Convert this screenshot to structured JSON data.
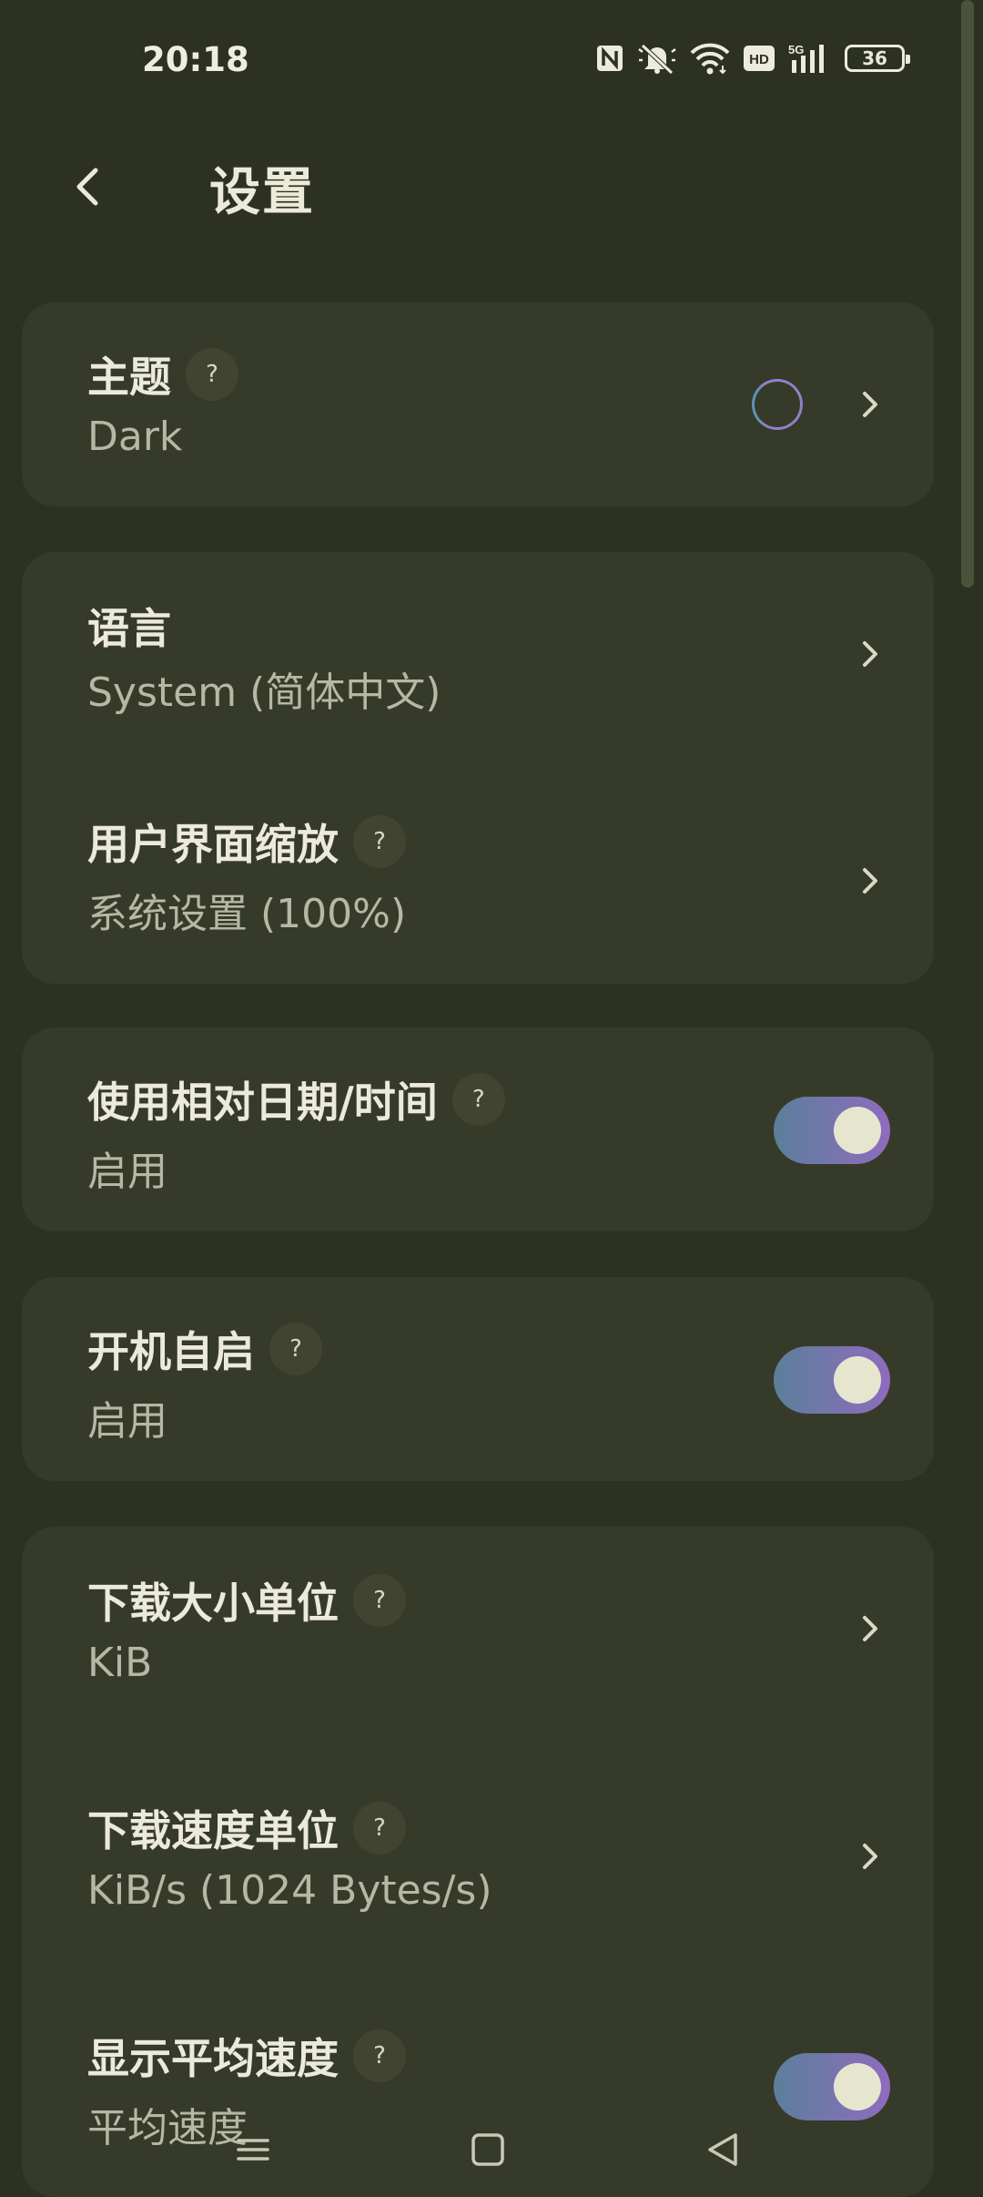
{
  "status_bar": {
    "time": "20:18",
    "icons": [
      "nfc-icon",
      "mute-icon",
      "wifi-icon",
      "hd-icon",
      "5g-signal-icon"
    ],
    "battery_level": "36"
  },
  "app_bar": {
    "title": "设置",
    "back_icon": "back-arrow-icon"
  },
  "settings": {
    "theme": {
      "title": "主题",
      "value": "Dark"
    },
    "language": {
      "title": "语言",
      "value": "System (简体中文)"
    },
    "ui_scale": {
      "title": "用户界面缩放",
      "value": "系统设置 (100%)"
    },
    "relative_date": {
      "title": "使用相对日期/时间",
      "value": "启用",
      "enabled": true
    },
    "autostart": {
      "title": "开机自启",
      "value": "启用",
      "enabled": true
    },
    "download_size_unit": {
      "title": "下载大小单位",
      "value": "KiB"
    },
    "download_speed_unit": {
      "title": "下载速度单位",
      "value": "KiB/s (1024 Bytes/s)"
    },
    "avg_speed": {
      "title": "显示平均速度",
      "value": "平均速度",
      "enabled": true
    }
  },
  "help_label": "?",
  "colors": {
    "background": "#2d3121",
    "card": "#363a28",
    "toggle_gradient_start": "#5b7f9a",
    "toggle_gradient_end": "#8f6bbf"
  }
}
